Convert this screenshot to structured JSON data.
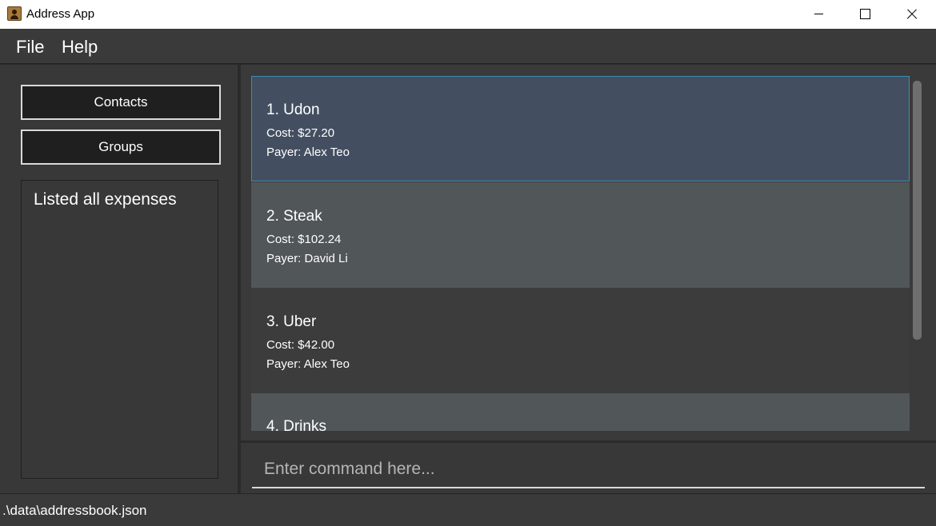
{
  "window": {
    "title": "Address App",
    "icon": "address-book-icon"
  },
  "menu": {
    "file_label": "File",
    "help_label": "Help"
  },
  "sidebar": {
    "contacts_label": "Contacts",
    "groups_label": "Groups",
    "result_message": "Listed all expenses"
  },
  "expenses": [
    {
      "title": "1. Udon",
      "cost": "Cost: $27.20",
      "payer": "Payer: Alex Teo"
    },
    {
      "title": "2. Steak",
      "cost": "Cost: $102.24",
      "payer": "Payer: David Li"
    },
    {
      "title": "3. Uber",
      "cost": "Cost: $42.00",
      "payer": "Payer: Alex Teo"
    },
    {
      "title": "4. Drinks"
    }
  ],
  "command": {
    "placeholder": "Enter command here...",
    "value": ""
  },
  "status": {
    "file_path": ".\\data\\addressbook.json"
  },
  "colors": {
    "background": "#2b2b2b",
    "panel": "#3a3a3a",
    "selected_card": "#434f61",
    "selected_border": "#3c8fb0",
    "alt_card": "#515658"
  }
}
